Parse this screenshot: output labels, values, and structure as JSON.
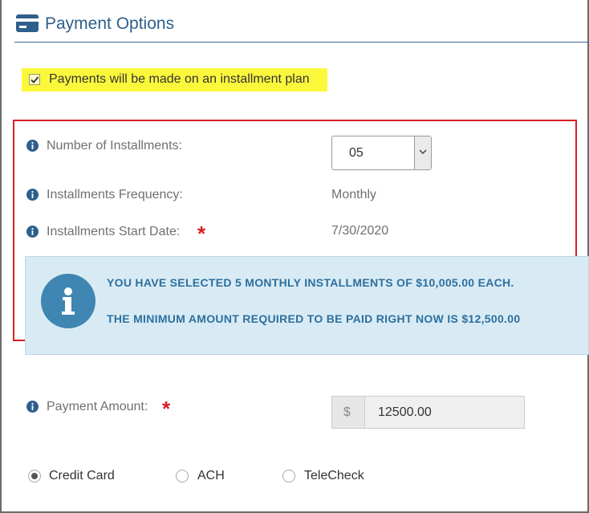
{
  "header": {
    "title": "Payment Options",
    "icon": "credit-card-icon"
  },
  "installment_checkbox": {
    "label": "Payments will be made on an installment plan",
    "checked": true
  },
  "fields": {
    "num_installments": {
      "label": "Number of Installments:",
      "value": "05"
    },
    "frequency": {
      "label": "Installments Frequency:",
      "value": "Monthly"
    },
    "start_date": {
      "label": "Installments Start Date:",
      "required_mark": "*",
      "value": "7/30/2020"
    }
  },
  "alert": {
    "line1": {
      "pre": "YOU HAVE SELECTED ",
      "count": "5",
      "mid": " MONTHLY INSTALLMENTS OF ",
      "amount": "$10,005.00",
      "post": " EACH."
    },
    "line2": {
      "pre": "THE MINIMUM AMOUNT REQUIRED TO BE PAID RIGHT NOW IS ",
      "amount": "$12,500.00"
    }
  },
  "payment_amount": {
    "label": "Payment Amount:",
    "required_mark": "*",
    "currency": "$",
    "value": "12500.00"
  },
  "payment_methods": [
    {
      "label": "Credit Card",
      "selected": true
    },
    {
      "label": "ACH",
      "selected": false
    },
    {
      "label": "TeleCheck",
      "selected": false
    }
  ],
  "colors": {
    "accent": "#2e5f8c",
    "highlight": "#fbf83c",
    "required": "#d81f26",
    "alert_bg": "#d8ebf4",
    "alert_text": "#2e6f9e"
  }
}
